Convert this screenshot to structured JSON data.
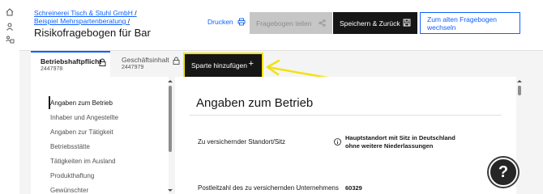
{
  "rail": {
    "icons": [
      "home-icon",
      "user-icon",
      "org-icon"
    ]
  },
  "header": {
    "breadcrumb_1": "Schreinerei Tisch & Stuhl GmbH",
    "breadcrumb_1_sep": "/",
    "breadcrumb_2": "Beispiel Mehrspartenberatung",
    "breadcrumb_2_sep": "/",
    "title": "Risikofragebogen für Bar",
    "print_label": "Drucken",
    "share_label": "Fragebogen teilen",
    "save_label": "Speichern & Zurück",
    "switch_label": "Zum alten Fragebogen wechseln"
  },
  "tabs": [
    {
      "title": "Betriebshaftpflicht",
      "number": "2447978",
      "active": true
    },
    {
      "title": "Geschäftsinhalt",
      "number": "2447979",
      "active": false
    }
  ],
  "add_tab_label": "Sparte hinzufügen",
  "add_tab_plus": "+",
  "nav": {
    "items": [
      {
        "label": "Angaben zum Betrieb",
        "active": true
      },
      {
        "label": "Inhaber und Angestellte",
        "active": false
      },
      {
        "label": "Angaben zur Tätigkeit",
        "active": false
      },
      {
        "label": "Betriebsstätte",
        "active": false
      },
      {
        "label": "Tätigkeiten im Ausland",
        "active": false
      },
      {
        "label": "Produkthaftung",
        "active": false
      },
      {
        "label": "Gewünschter",
        "active": false
      }
    ]
  },
  "main": {
    "heading": "Angaben zum Betrieb",
    "rows": [
      {
        "label": "Zu versichernder Standort/Sitz",
        "value_line1": "Hauptstandort mit Sitz in Deutschland",
        "value_line2": "ohne weitere Niederlassungen"
      },
      {
        "label": "Postleitzahl des zu versichernden Unternehmens",
        "value_line1": "60329"
      }
    ]
  },
  "help_label": "?",
  "colors": {
    "accent": "#0f62fe",
    "highlight": "#f1e20f",
    "dark": "#161616",
    "disabled": "#c6c6c6"
  }
}
